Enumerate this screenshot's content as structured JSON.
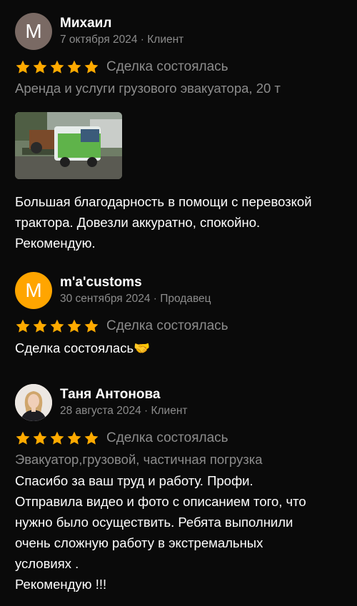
{
  "colors": {
    "background": "#0a0a0a",
    "star": "#ffaa00",
    "muted": "#8c8c8c",
    "avatar_gray": "#7a6a64",
    "avatar_orange": "#ffa500"
  },
  "reviews": [
    {
      "avatar_letter": "М",
      "name": "Михаил",
      "meta": "7 октября 2024 · Клиент",
      "rating": 5,
      "deal_status": "Сделка состоялась",
      "service": "Аренда и услуги грузового эвакуатора, 20 т",
      "photo_icon": "tow-truck-photo",
      "text": "Большая благодарность в помощи с перевозкой\nтрактора. Довезли аккуратно, спокойно.\nРекомендую."
    },
    {
      "avatar_letter": "M",
      "name": "m'a'customs",
      "meta": "30 сентября 2024 · Продавец",
      "rating": 5,
      "deal_status": "Сделка состоялась",
      "text": "Сделка состоялась🤝"
    },
    {
      "avatar_icon": "user-photo",
      "name": "Таня Антонова",
      "meta": "28 августа 2024 · Клиент",
      "rating": 5,
      "deal_status": "Сделка состоялась",
      "service": "Эвакуатор,грузовой, частичная погрузка",
      "text": "Спасибо за ваш труд и  работу.  Профи.\nОтправила видео и фото с описанием того, что\nнужно было осуществить. Ребята выполнили\nочень сложную работу в экстремальных\nусловиях .\nРекомендую !!!"
    }
  ]
}
